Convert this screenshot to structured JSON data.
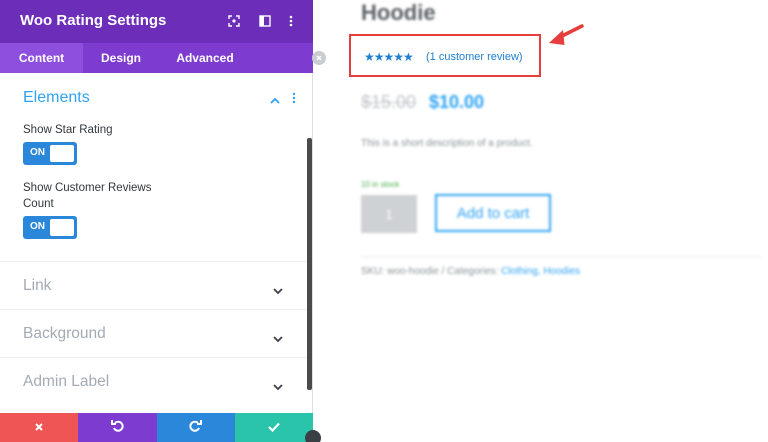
{
  "panel": {
    "title": "Woo Rating Settings",
    "header_icons": [
      "focus-icon",
      "split-view-icon",
      "more-vertical-icon"
    ],
    "tabs": [
      {
        "label": "Content",
        "active": true
      },
      {
        "label": "Design",
        "active": false
      },
      {
        "label": "Advanced",
        "active": false
      }
    ],
    "elements_group": {
      "title": "Elements",
      "fields": [
        {
          "label": "Show Star Rating",
          "toggle": "ON"
        },
        {
          "label": "Show Customer Reviews Count",
          "toggle": "ON"
        }
      ]
    },
    "collapsed_groups": [
      {
        "title": "Link"
      },
      {
        "title": "Background"
      },
      {
        "title": "Admin Label"
      }
    ],
    "footer_buttons": [
      {
        "name": "discard",
        "icon": "close-icon",
        "color": "#ef5555"
      },
      {
        "name": "undo",
        "icon": "undo-icon",
        "color": "#7e3bd0"
      },
      {
        "name": "redo",
        "icon": "redo-icon",
        "color": "#2b87da"
      },
      {
        "name": "save",
        "icon": "check-icon",
        "color": "#29c4a9"
      }
    ]
  },
  "preview": {
    "product_title": "Hoodie",
    "rating_stars": "★★★★★",
    "review_link": "(1 customer review)",
    "old_price": "$15.00",
    "new_price": "$10.00",
    "short_description": "This is a short description of a product.",
    "stock": "10 in stock",
    "quantity": "1",
    "add_to_cart": "Add to cart",
    "sku_text": "SKU: woo-hoodie / Categories: ",
    "categories": "Clothing, Hoodies"
  },
  "colors": {
    "header_purple": "#6c2eb9",
    "tabs_purple": "#7d3bcf",
    "accent_blue": "#2ea3f2",
    "highlight_red": "#e63d3d"
  }
}
